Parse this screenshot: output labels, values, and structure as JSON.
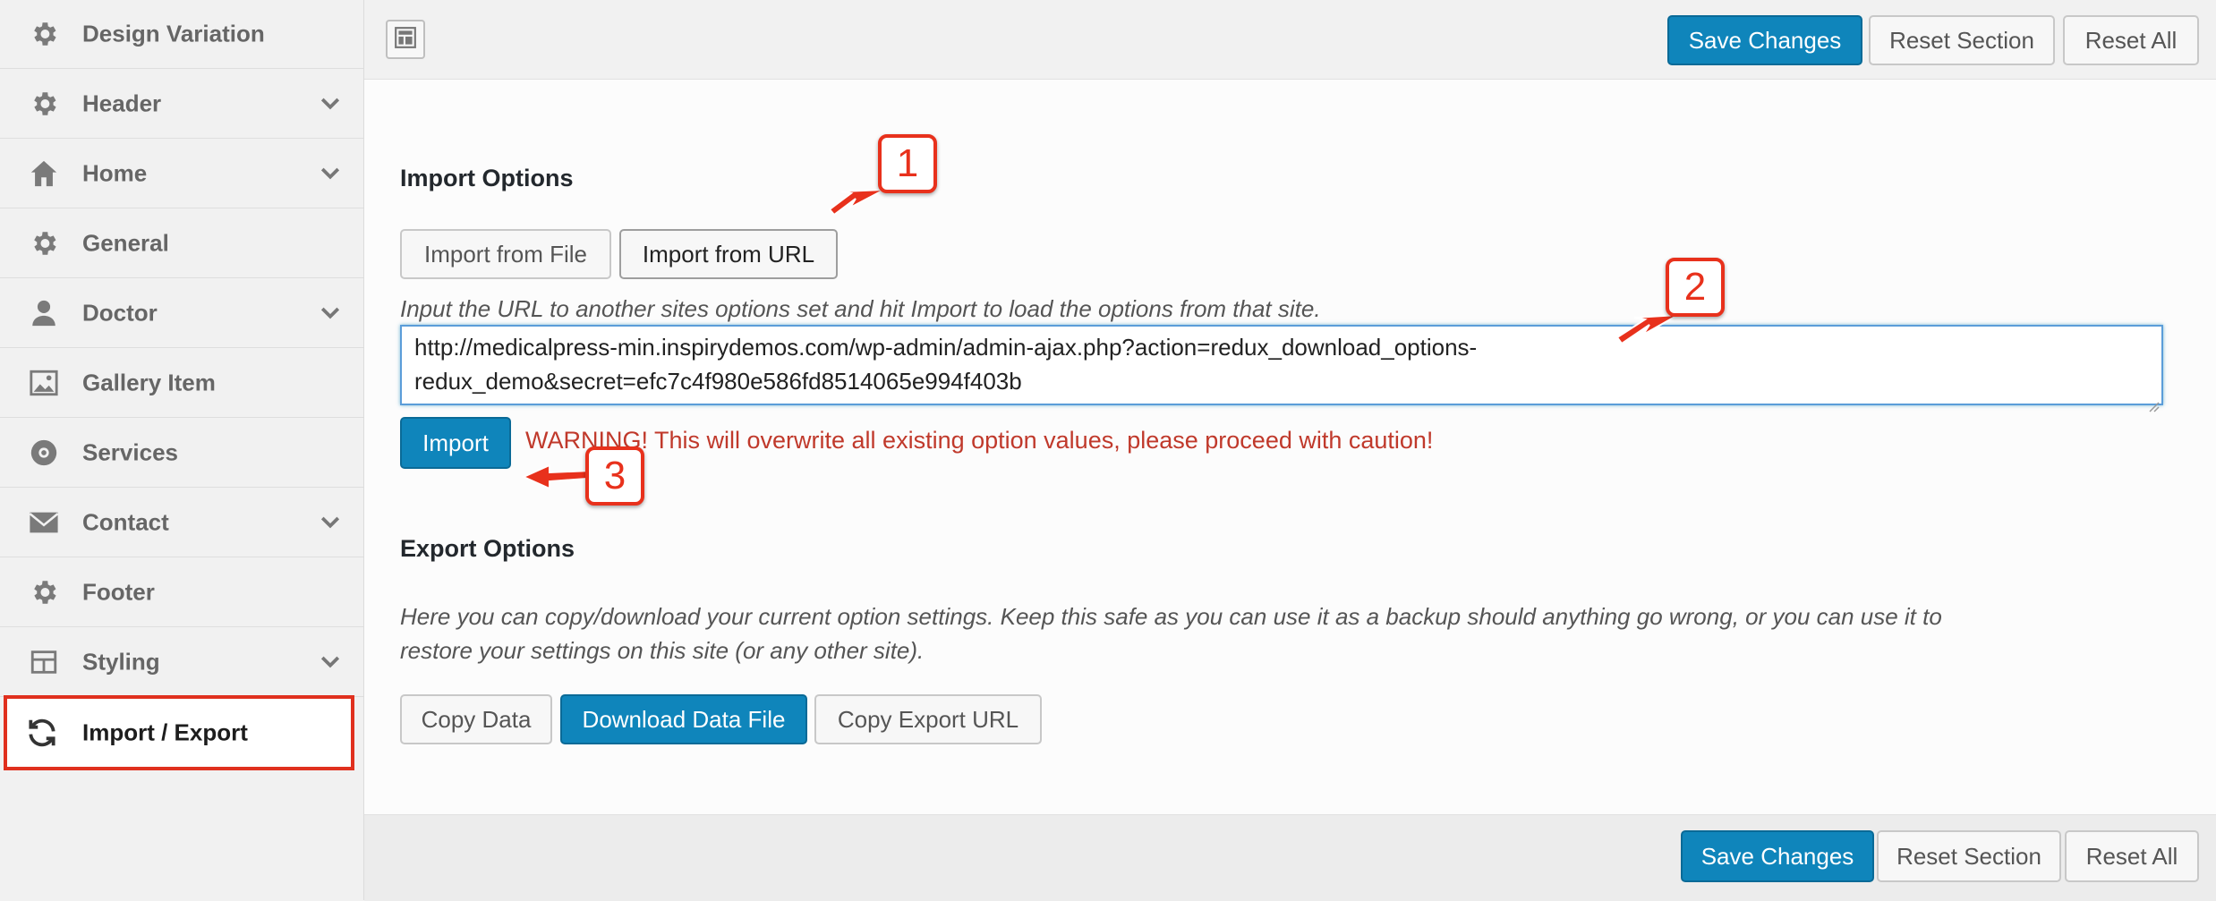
{
  "sidebar": {
    "items": [
      {
        "label": "Design Variation",
        "icon": "gear-icon",
        "has_chevron": false
      },
      {
        "label": "Header",
        "icon": "gear-icon",
        "has_chevron": true
      },
      {
        "label": "Home",
        "icon": "home-icon",
        "has_chevron": true
      },
      {
        "label": "General",
        "icon": "gear-icon",
        "has_chevron": false
      },
      {
        "label": "Doctor",
        "icon": "user-icon",
        "has_chevron": true
      },
      {
        "label": "Gallery Item",
        "icon": "image-icon",
        "has_chevron": false
      },
      {
        "label": "Services",
        "icon": "settings-circle-icon",
        "has_chevron": false
      },
      {
        "label": "Contact",
        "icon": "envelope-icon",
        "has_chevron": true
      },
      {
        "label": "Footer",
        "icon": "gear-icon",
        "has_chevron": false
      },
      {
        "label": "Styling",
        "icon": "layout-icon",
        "has_chevron": true
      },
      {
        "label": "Import / Export",
        "icon": "refresh-icon",
        "has_chevron": false,
        "active": true
      }
    ]
  },
  "toolbar": {
    "save_label": "Save Changes",
    "reset_section_label": "Reset Section",
    "reset_all_label": "Reset All"
  },
  "import": {
    "title": "Import Options",
    "from_file_label": "Import from File",
    "from_url_label": "Import from URL",
    "description": "Input the URL to another sites options set and hit Import to load the options from that site.",
    "url_value": "http://medicalpress-min.inspirydemos.com/wp-admin/admin-ajax.php?action=redux_download_options-redux_demo&secret=efc7c4f980e586fd8514065e994f403b",
    "url_line1": "http://medicalpress-min.inspirydemos.com/wp-admin/admin-ajax.php?action=redux_download_options-",
    "url_line2": "redux_demo&secret=efc7c4f980e586fd8514065e994f403b",
    "import_button_label": "Import",
    "warning": "WARNING! This will overwrite all existing option values, please proceed with caution!"
  },
  "export": {
    "title": "Export Options",
    "description_line1": "Here you can copy/download your current option settings. Keep this safe as you can use it as a backup should anything go wrong, or you can use it to",
    "description_line2": "restore your settings on this site (or any other site).",
    "copy_data_label": "Copy Data",
    "download_label": "Download Data File",
    "copy_url_label": "Copy Export URL"
  },
  "annotations": {
    "callout_1": "1",
    "callout_2": "2",
    "callout_3": "3",
    "highlight_color": "#e8311c"
  },
  "colors": {
    "primary": "#0f85bb",
    "warning": "#c0392b"
  }
}
